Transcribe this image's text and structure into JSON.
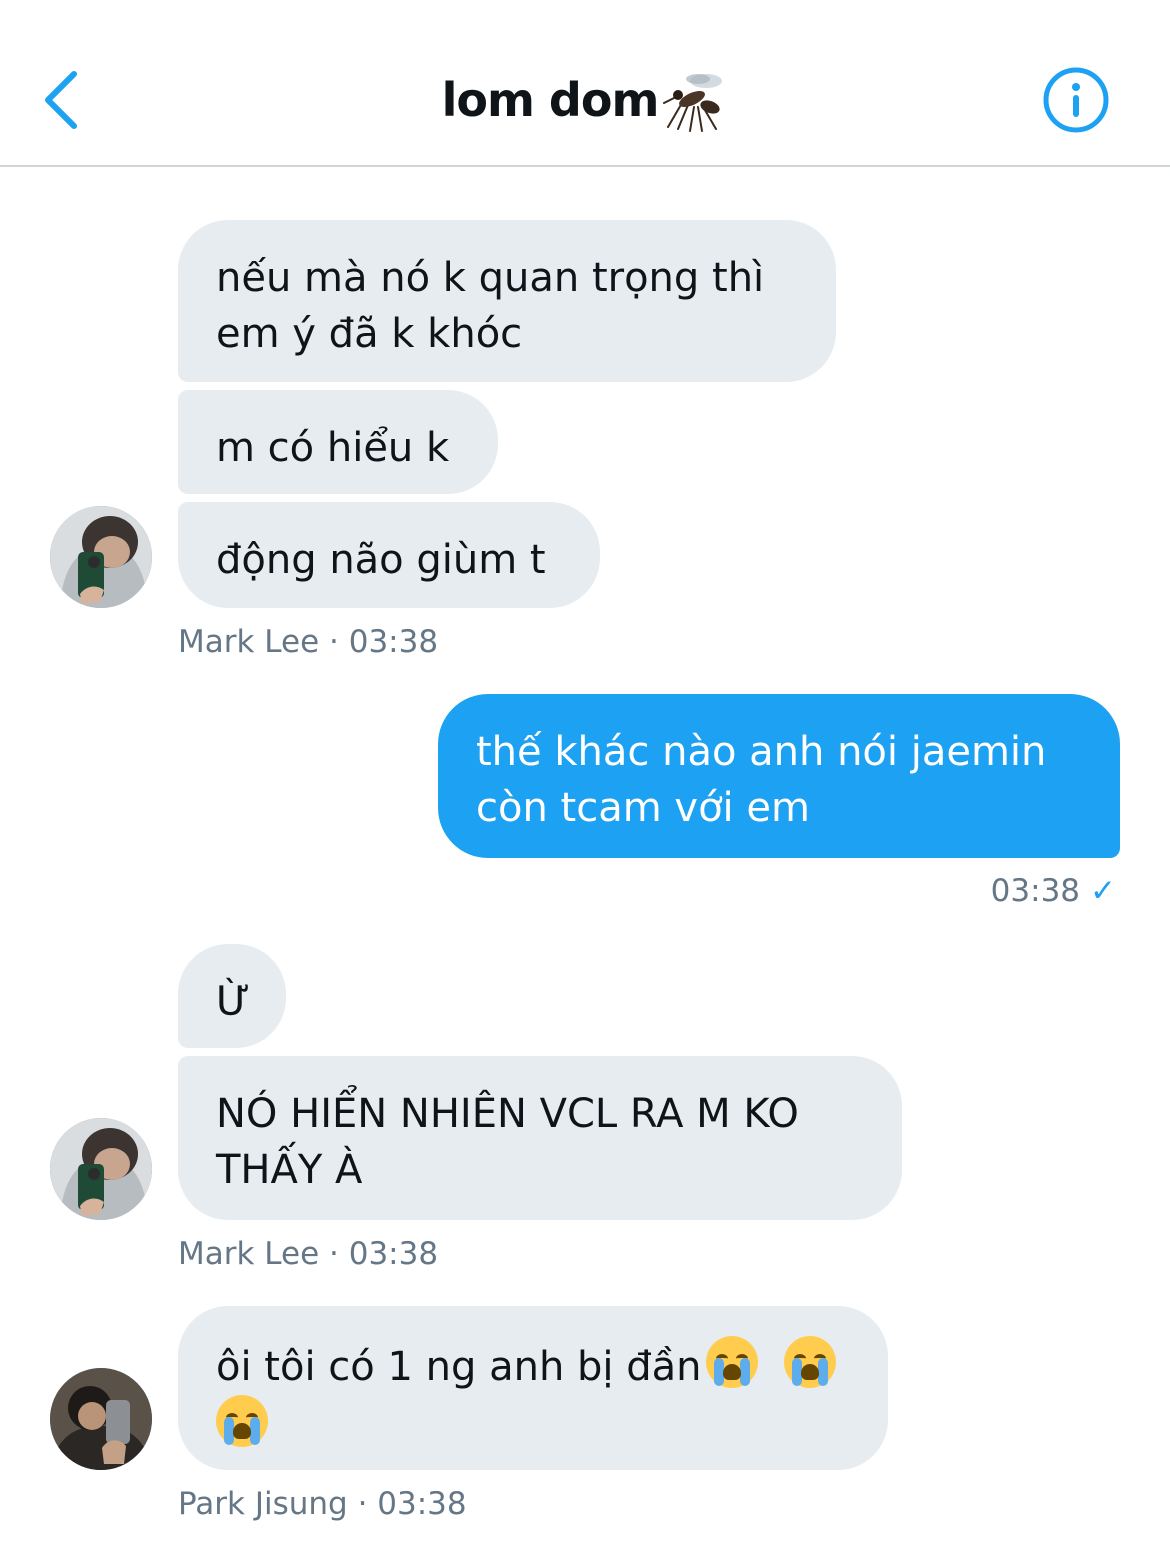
{
  "header": {
    "title": "lom dom",
    "title_emoji": "mosquito",
    "back_icon": "chevron-left-icon",
    "info_icon": "info-icon"
  },
  "colors": {
    "accent": "#1da1f2",
    "received_bubble": "#e6ecf0",
    "meta_text": "#657786",
    "title_text": "#0f1419"
  },
  "messages": {
    "g1": {
      "m1": "nếu mà nó k quan trọng thì em ý đã k khóc",
      "m2": "m có hiểu k",
      "m3": "động não giùm t",
      "meta": "Mark Lee · 03:38"
    },
    "s1": {
      "text": "thế khác nào anh nói jaemin còn tcam với em",
      "time": "03:38",
      "status_icon": "check-icon"
    },
    "g2": {
      "m1": "Ừ",
      "m2": "NÓ HIỂN NHIÊN VCL RA M KO THẤY À",
      "meta": "Mark Lee · 03:38"
    },
    "g3": {
      "text": "ôi tôi có 1 ng anh bị đần",
      "emojis": [
        "loudly-crying-face",
        "loudly-crying-face",
        "loudly-crying-face"
      ],
      "meta": "Park Jisung · 03:38"
    }
  }
}
